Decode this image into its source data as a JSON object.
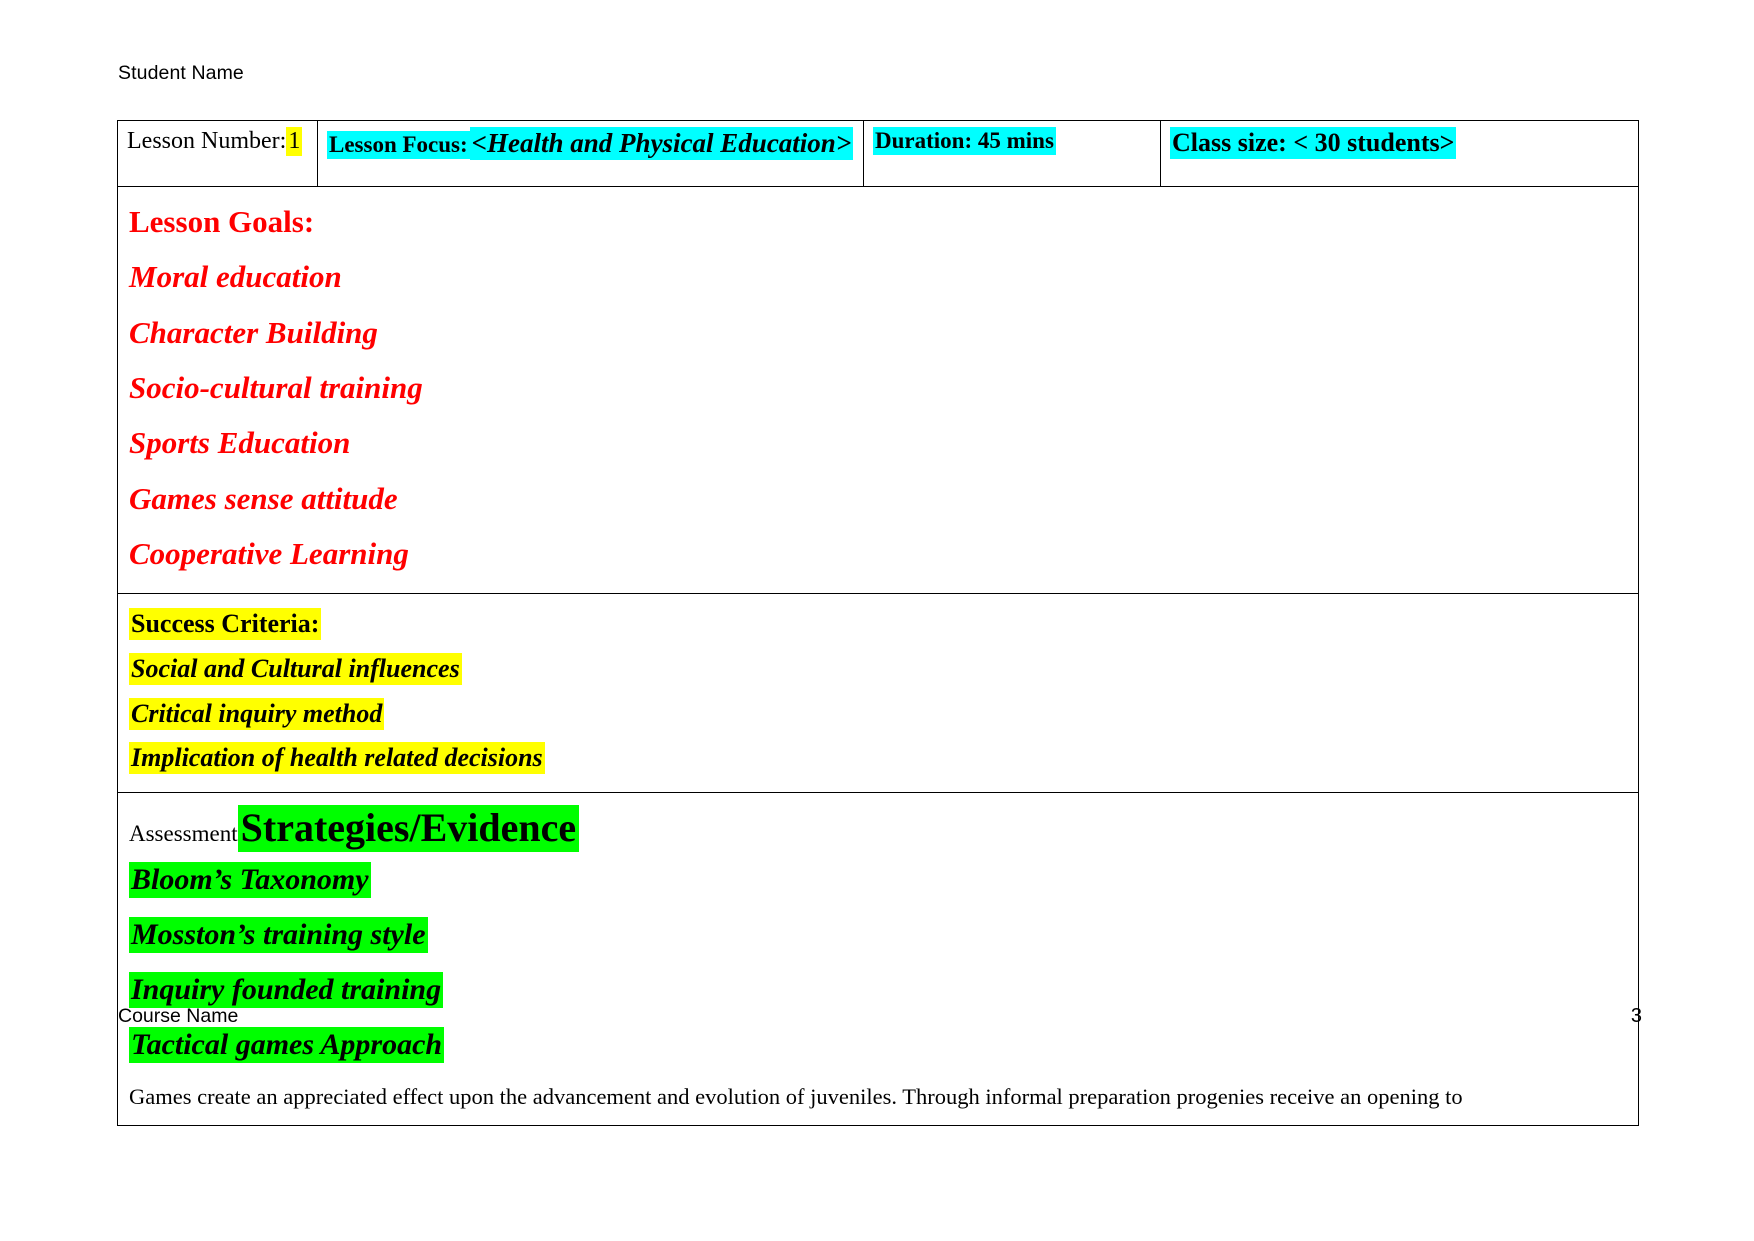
{
  "document": {
    "running_header": "Student Name",
    "running_footer": "Course Name",
    "page_number": "3"
  },
  "colors": {
    "highlight_yellow": "#ffff00",
    "highlight_cyan": "#00ffff",
    "highlight_green": "#00ff00",
    "goal_text_red": "#ff0000",
    "body_text": "#000000",
    "border": "#000000"
  },
  "header_row": {
    "lesson_number_label": "Lesson Number:",
    "lesson_number_value": "1",
    "lesson_focus_label": "Lesson Focus:",
    "lesson_focus_value": "<Health and Physical Education>",
    "duration": "Duration: 45 mins",
    "class_size": "Class size: < 30 students>"
  },
  "lesson_goals": {
    "heading": "Lesson Goals:",
    "items": [
      "Moral education",
      "Character Building",
      "Socio-cultural training",
      "Sports Education",
      "Games sense attitude",
      "Cooperative Learning"
    ]
  },
  "success_criteria": {
    "heading": "Success Criteria:",
    "items": [
      "Social and Cultural influences",
      "Critical inquiry method",
      "Implication of health related decisions"
    ]
  },
  "assessment": {
    "label": "Assessment",
    "heading": "Strategies/Evidence",
    "items": [
      "Bloom’s Taxonomy",
      "Mosston’s training style",
      "Inquiry founded training",
      "Tactical games Approach"
    ],
    "paragraph": "Games create an appreciated effect upon the advancement and evolution of juveniles. Through informal preparation progenies receive an opening to"
  }
}
